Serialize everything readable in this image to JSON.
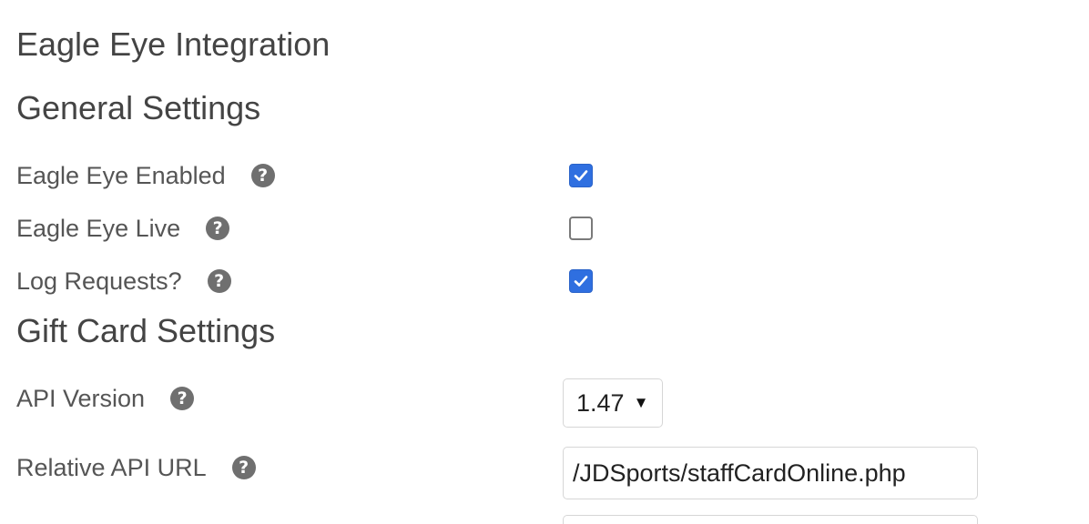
{
  "page": {
    "title": "Eagle Eye Integration"
  },
  "general": {
    "heading": "General Settings",
    "rows": [
      {
        "label": "Eagle Eye Enabled",
        "checked": true
      },
      {
        "label": "Eagle Eye Live",
        "checked": false
      },
      {
        "label": "Log Requests?",
        "checked": true
      }
    ]
  },
  "gift_card": {
    "heading": "Gift Card Settings",
    "api_version": {
      "label": "API Version",
      "value": "1.47"
    },
    "relative_api_url": {
      "label": "Relative API URL",
      "value": "/JDSports/staffCardOnline.php"
    }
  },
  "icons": {
    "help": "?",
    "select_arrow": "▼"
  },
  "colors": {
    "checkbox_checked": "#2f6fe0",
    "help_icon": "#6f6f6f",
    "text": "#444444"
  }
}
